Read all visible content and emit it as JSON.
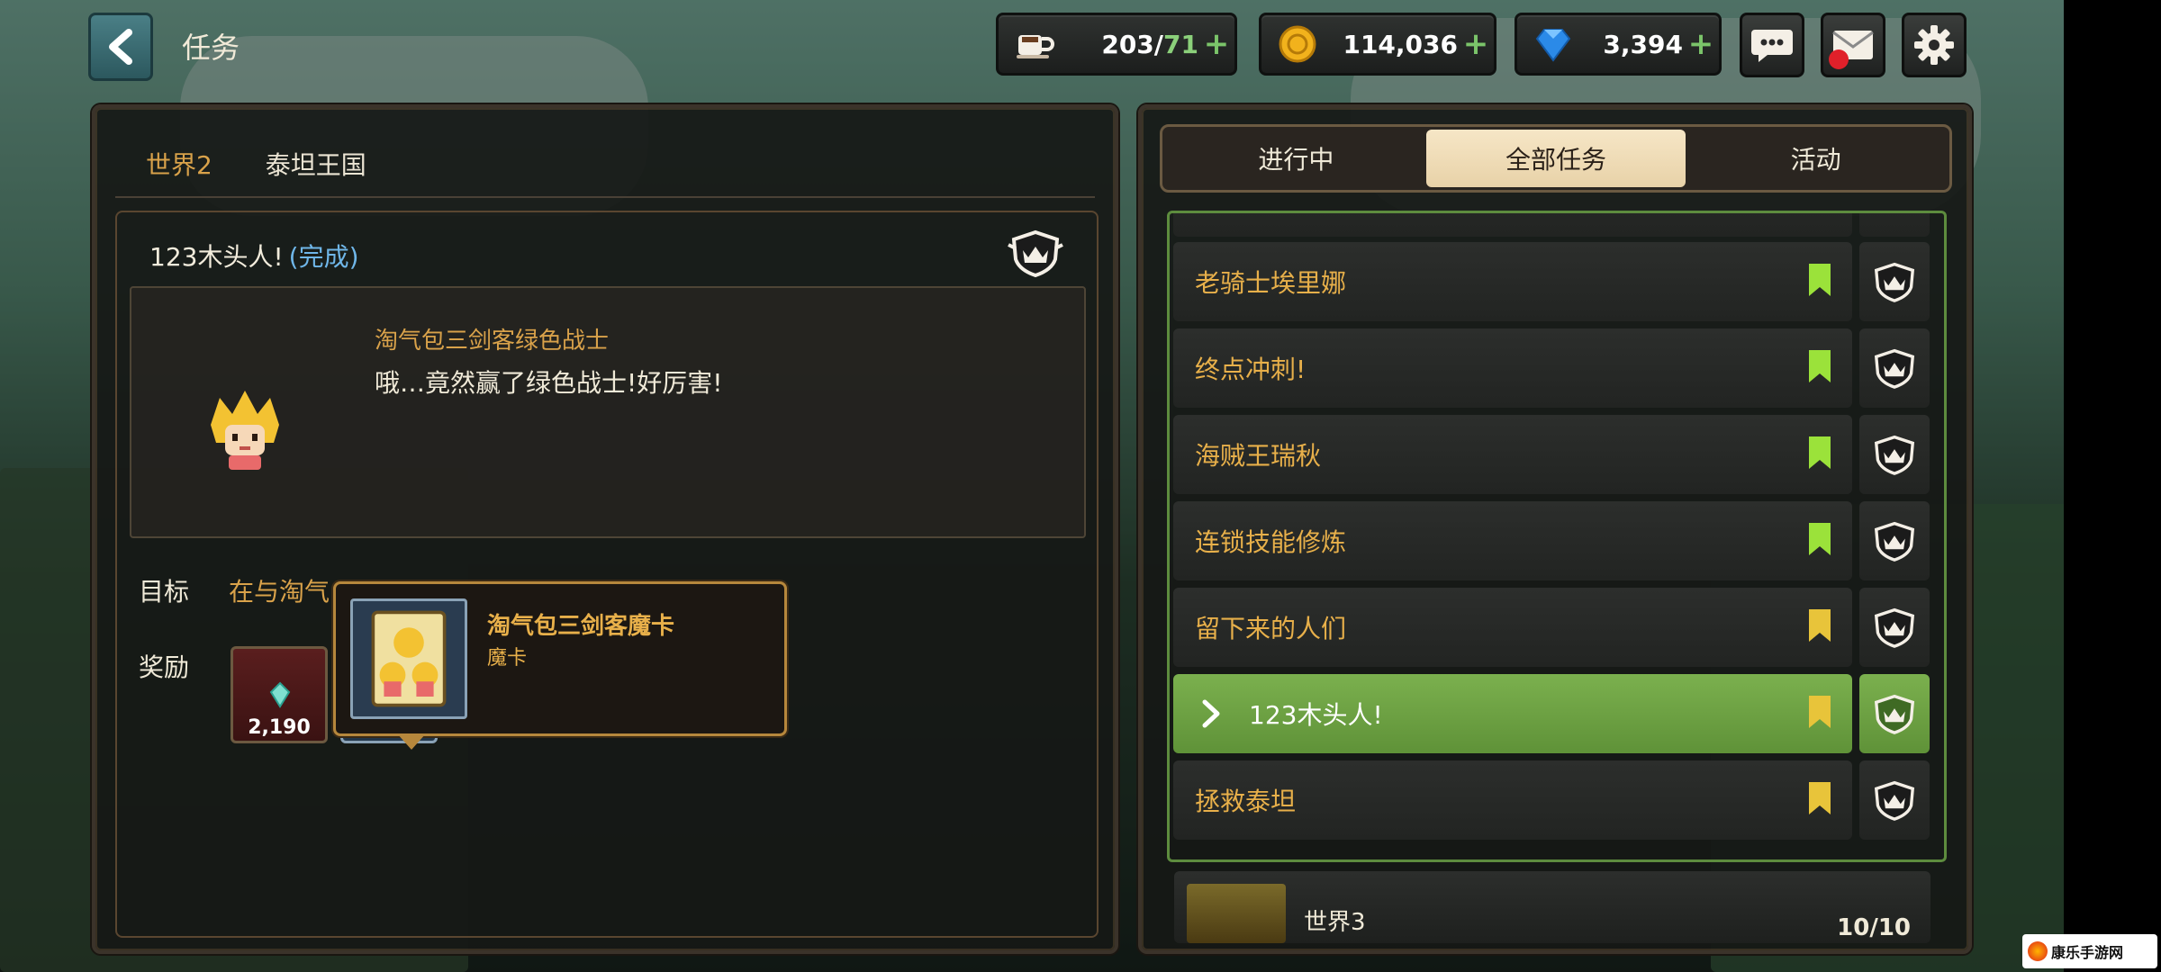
{
  "header": {
    "title": "任务",
    "resources": {
      "stamina": {
        "value": "203",
        "max": "71",
        "icon": "coffee-cup-icon"
      },
      "gold": {
        "value": "114,036",
        "icon": "gold-coin-icon"
      },
      "gems": {
        "value": "3,394",
        "icon": "blue-gem-icon"
      }
    },
    "buttons": {
      "chat": "chat-bubble-icon",
      "mail": "mail-icon",
      "settings": "gear-icon"
    }
  },
  "left": {
    "world": "世界2",
    "kingdom": "泰坦王国",
    "quest_title": "123木头人!",
    "quest_status": "(完成)",
    "speaker": "淘气包三剑客绿色战士",
    "speech": "哦…竟然赢了绿色战士!好厉害!",
    "goal_label": "目标",
    "goal_text": "在与淘气",
    "reward_label": "奖励",
    "reward_gem_count": "2,190",
    "tooltip": {
      "name": "淘气包三剑客魔卡",
      "type": "魔卡"
    }
  },
  "right": {
    "tabs": [
      "进行中",
      "全部任务",
      "活动"
    ],
    "active_tab": 1,
    "quests": [
      {
        "name": "老骑士埃里娜",
        "mark": "green"
      },
      {
        "name": "终点冲刺!",
        "mark": "green"
      },
      {
        "name": "海贼王瑞秋",
        "mark": "green"
      },
      {
        "name": "连锁技能修炼",
        "mark": "green"
      },
      {
        "name": "留下来的人们",
        "mark": "yellow"
      },
      {
        "name": "123木头人!",
        "mark": "yellow",
        "active": true
      },
      {
        "name": "拯救泰坦",
        "mark": "yellow"
      }
    ],
    "next_world": {
      "name": "世界3",
      "progress": "10/10"
    }
  },
  "colors": {
    "accent_gold": "#e8b04a",
    "active_green": "#6ea444",
    "mark_green": "#9be23a",
    "mark_yellow": "#e8c43a"
  },
  "watermark": "康乐手游网"
}
